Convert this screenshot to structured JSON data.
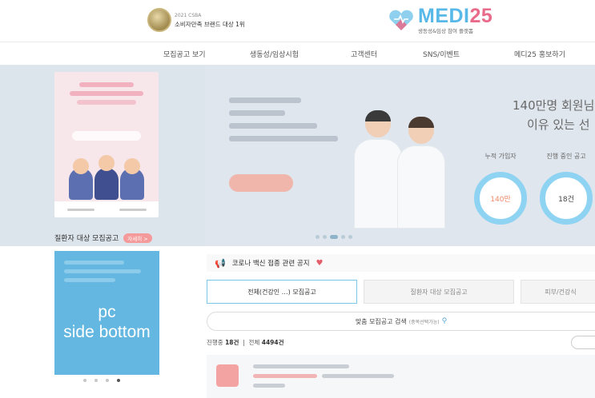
{
  "header": {
    "award_year": "2021 CSBA",
    "award_title": "소비자만족 브랜드 대상 1위",
    "logo_name_a": "MEDI",
    "logo_name_b": "25",
    "logo_tagline": "생동성&임상 참여 플랫폼"
  },
  "nav": {
    "items": [
      {
        "label": "모집공고 보기"
      },
      {
        "label": "생동성/임상시험"
      },
      {
        "label": "고객센터"
      },
      {
        "label": "SNS/이벤트"
      },
      {
        "label": "메디25 홍보하기"
      }
    ]
  },
  "hero": {
    "headline_line1": "140만명 회원님",
    "headline_line2": "이유 있는 선",
    "stats": [
      {
        "label": "누적 가입자",
        "value": "140만",
        "color": "#f08a6a"
      },
      {
        "label": "진행 중인 공고",
        "value": "18건",
        "color": "#444444"
      }
    ],
    "slide_count": 6,
    "active_slide": 3
  },
  "sidebar": {
    "section_title": "질환자 대상 모집공고",
    "section_badge": "자세히 >",
    "ad_line1": "pc",
    "ad_line2": "side bottom",
    "ad_dots": 4,
    "ad_active": 4
  },
  "notice": {
    "text": "코로나 백신 접종 관련 공지",
    "icon": "megaphone-icon"
  },
  "tabs": [
    {
      "label": "전체(건강인 …) 모집공고",
      "active": true
    },
    {
      "label": "질환자 대상 모집공고",
      "active": false
    },
    {
      "label": "피부/건강식",
      "active": false
    }
  ],
  "search": {
    "label": "맞춤 모집공고 검색",
    "hint": "(중복선택가능)"
  },
  "counts": {
    "ongoing_label": "진행중",
    "ongoing_value": "18건",
    "sep": "|",
    "total_label": "전체",
    "total_value": "4494건"
  },
  "colors": {
    "accent_blue": "#7cc6ea",
    "brand_pink": "#e86b8a",
    "ad_blue": "#63b7e1"
  }
}
